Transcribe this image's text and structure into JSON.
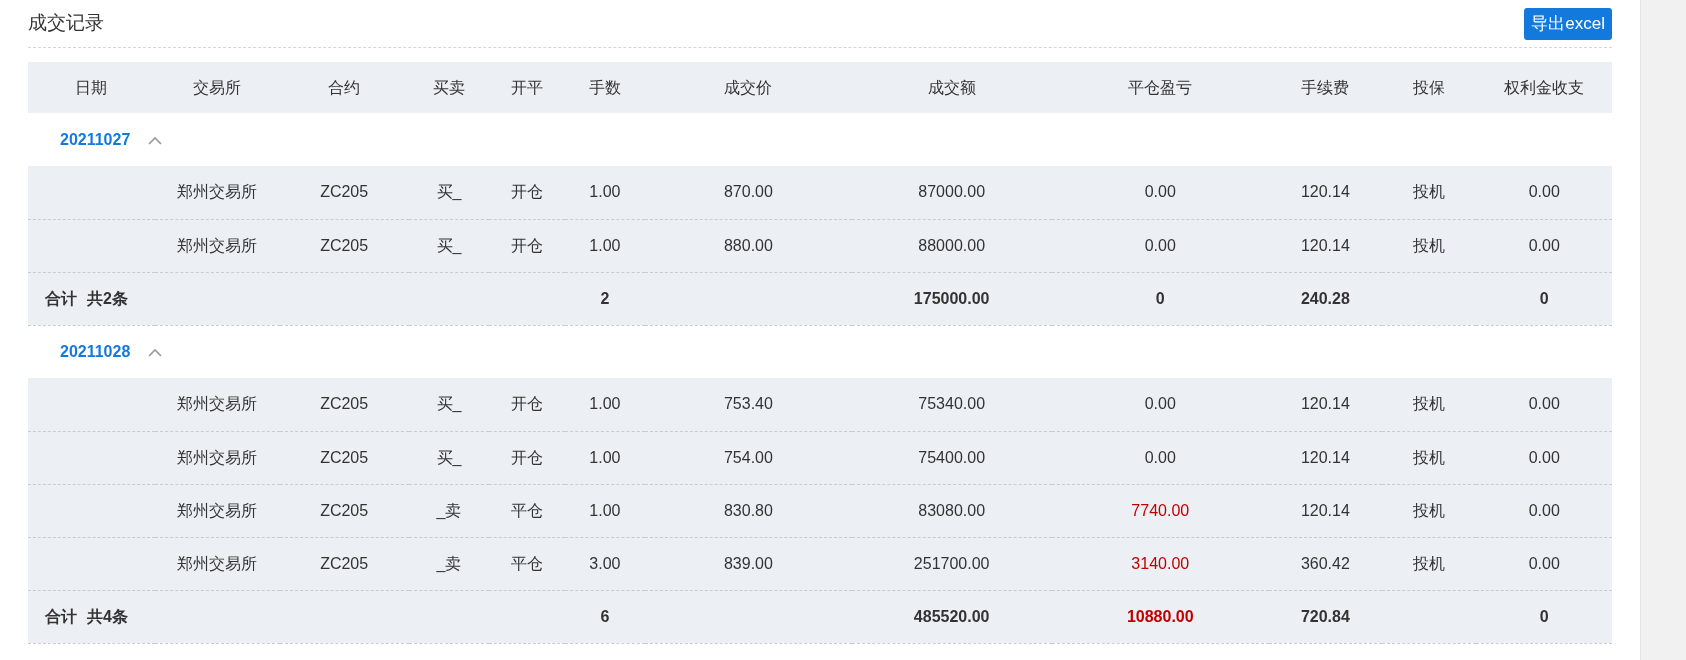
{
  "title": "成交记录",
  "export_button": "导出excel",
  "columns": [
    "日期",
    "交易所",
    "合约",
    "买卖",
    "开平",
    "手数",
    "成交价",
    "成交额",
    "平仓盈亏",
    "手续费",
    "投保",
    "权利金收支"
  ],
  "groups": [
    {
      "date": "20211027",
      "expanded": true,
      "rows": [
        {
          "exchange": "郑州交易所",
          "contract": "ZC205",
          "side": "买_",
          "offset": "开仓",
          "lots": "1.00",
          "price": "870.00",
          "amount": "87000.00",
          "pnl": "0.00",
          "fee": "120.14",
          "hedge": "投机",
          "premium": "0.00"
        },
        {
          "exchange": "郑州交易所",
          "contract": "ZC205",
          "side": "买_",
          "offset": "开仓",
          "lots": "1.00",
          "price": "880.00",
          "amount": "88000.00",
          "pnl": "0.00",
          "fee": "120.14",
          "hedge": "投机",
          "premium": "0.00"
        }
      ],
      "total": {
        "label": "合计",
        "count": "共2条",
        "lots": "2",
        "amount": "175000.00",
        "pnl": "0",
        "fee": "240.28",
        "premium": "0"
      }
    },
    {
      "date": "20211028",
      "expanded": true,
      "rows": [
        {
          "exchange": "郑州交易所",
          "contract": "ZC205",
          "side": "买_",
          "offset": "开仓",
          "lots": "1.00",
          "price": "753.40",
          "amount": "75340.00",
          "pnl": "0.00",
          "fee": "120.14",
          "hedge": "投机",
          "premium": "0.00"
        },
        {
          "exchange": "郑州交易所",
          "contract": "ZC205",
          "side": "买_",
          "offset": "开仓",
          "lots": "1.00",
          "price": "754.00",
          "amount": "75400.00",
          "pnl": "0.00",
          "fee": "120.14",
          "hedge": "投机",
          "premium": "0.00"
        },
        {
          "exchange": "郑州交易所",
          "contract": "ZC205",
          "side": "_卖",
          "offset": "平仓",
          "lots": "1.00",
          "price": "830.80",
          "amount": "83080.00",
          "pnl": "7740.00",
          "color": "#c00000",
          "fee": "120.14",
          "hedge": "投机",
          "premium": "0.00"
        },
        {
          "exchange": "郑州交易所",
          "contract": "ZC205",
          "side": "_卖",
          "offset": "平仓",
          "lots": "3.00",
          "price": "839.00",
          "amount": "251700.00",
          "pnl": "3140.00",
          "color": "#c00000",
          "fee": "360.42",
          "hedge": "投机",
          "premium": "0.00"
        }
      ],
      "total": {
        "label": "合计",
        "count": "共4条",
        "lots": "6",
        "amount": "485520.00",
        "pnl": "10880.00",
        "color": "#c00000",
        "fee": "720.84",
        "premium": "0"
      }
    }
  ]
}
